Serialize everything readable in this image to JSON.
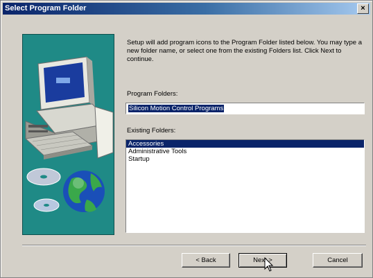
{
  "window": {
    "title": "Select Program Folder",
    "close_label": "×"
  },
  "instructions": "Setup will add program icons to the Program Folder listed below. You may type a new folder name, or select one from the existing Folders list.  Click Next to continue.",
  "program_folder": {
    "label": "Program Folders:",
    "value": "Silicon Motion Control Programs"
  },
  "existing_folders": {
    "label": "Existing Folders:",
    "items": [
      "Accessories",
      "Administrative Tools",
      "Startup"
    ],
    "selected": "Accessories"
  },
  "buttons": {
    "back": "< Back",
    "next": "Next >",
    "cancel": "Cancel"
  },
  "icons": {
    "art": "computer-and-globe-illustration",
    "cursor": "mouse-pointer-icon"
  },
  "colors": {
    "title_gradient_start": "#0a246a",
    "title_gradient_end": "#a6caf0",
    "panel_teal": "#1f8a86",
    "selection": "#0a246a",
    "dialog_face": "#d4d0c8"
  }
}
